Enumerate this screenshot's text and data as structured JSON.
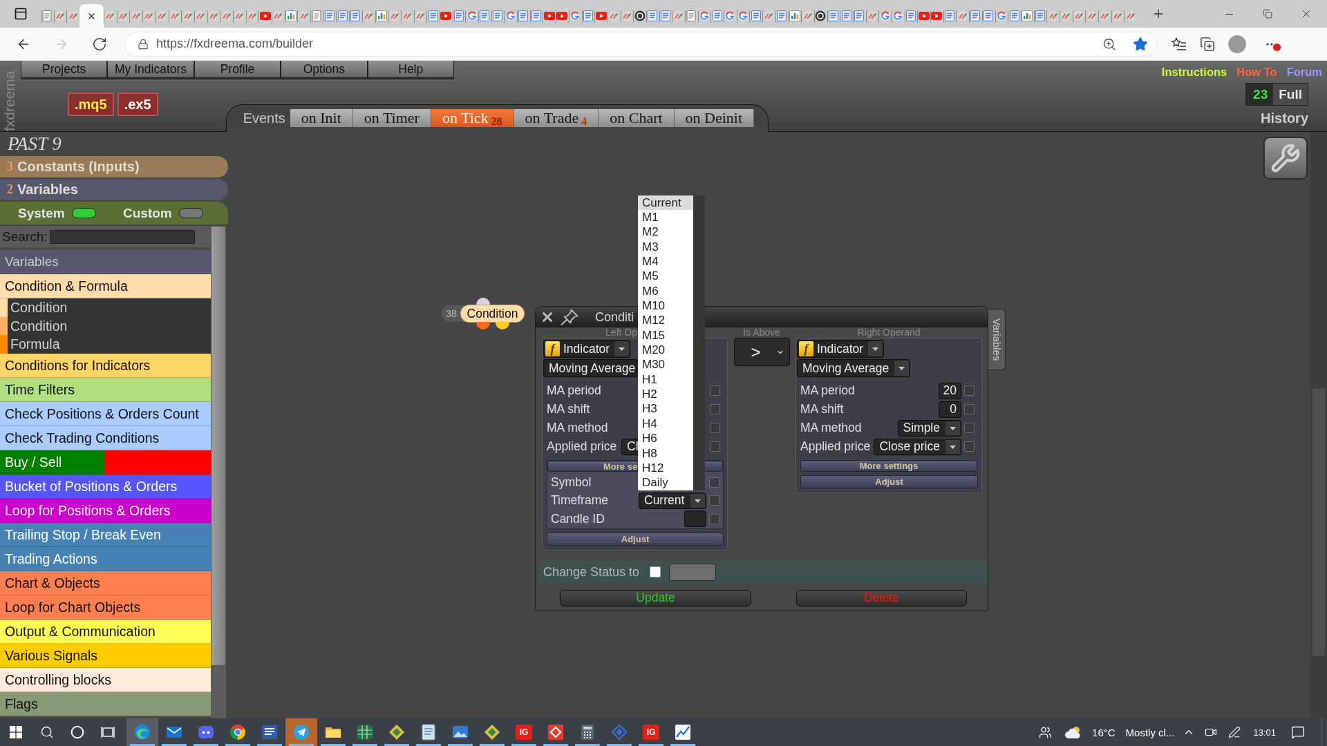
{
  "browser": {
    "tabs": [
      {
        "kind": "page",
        "selected": false
      },
      {
        "kind": "fx",
        "selected": false
      },
      {
        "kind": "fx",
        "selected": false
      },
      {
        "selected": true
      },
      {
        "kind": "fx",
        "selected": false
      },
      {
        "kind": "fx",
        "selected": false
      },
      {
        "kind": "fx",
        "selected": false
      },
      {
        "kind": "fx",
        "selected": false
      },
      {
        "kind": "fx",
        "selected": false
      },
      {
        "kind": "fx",
        "selected": false
      },
      {
        "kind": "fx",
        "selected": false
      },
      {
        "kind": "fx",
        "selected": false
      },
      {
        "kind": "fx",
        "selected": false
      },
      {
        "kind": "fx",
        "selected": false
      },
      {
        "kind": "fx",
        "selected": false
      },
      {
        "kind": "fx",
        "selected": false
      },
      {
        "kind": "youtube",
        "selected": false
      },
      {
        "kind": "fx",
        "selected": false
      },
      {
        "kind": "chart",
        "selected": false
      },
      {
        "kind": "fx",
        "selected": false
      },
      {
        "kind": "page",
        "selected": false
      },
      {
        "kind": "doc",
        "selected": false
      },
      {
        "kind": "doc",
        "selected": false
      },
      {
        "kind": "doc",
        "selected": false
      },
      {
        "kind": "fx",
        "selected": false
      },
      {
        "kind": "chart",
        "selected": false
      },
      {
        "kind": "fx",
        "selected": false
      },
      {
        "kind": "fx",
        "selected": false
      },
      {
        "kind": "fx",
        "selected": false
      },
      {
        "kind": "doc",
        "selected": false
      },
      {
        "kind": "youtube",
        "selected": false
      },
      {
        "kind": "doc",
        "selected": false
      },
      {
        "kind": "google",
        "selected": false
      },
      {
        "kind": "doc",
        "selected": false
      },
      {
        "kind": "doc",
        "selected": false
      },
      {
        "kind": "google",
        "selected": false
      },
      {
        "kind": "doc",
        "selected": false
      },
      {
        "kind": "doc",
        "selected": false
      },
      {
        "kind": "youtube",
        "selected": false
      },
      {
        "kind": "youtube",
        "selected": false
      },
      {
        "kind": "google",
        "selected": false
      },
      {
        "kind": "doc",
        "selected": false
      },
      {
        "kind": "youtube",
        "selected": false
      },
      {
        "kind": "fx",
        "selected": false
      },
      {
        "kind": "fx",
        "selected": false
      },
      {
        "kind": "circle",
        "selected": false
      },
      {
        "kind": "doc",
        "selected": false
      },
      {
        "kind": "doc",
        "selected": false
      },
      {
        "kind": "fx",
        "selected": false
      },
      {
        "kind": "page",
        "selected": false
      },
      {
        "kind": "google",
        "selected": false
      },
      {
        "kind": "doc",
        "selected": false
      },
      {
        "kind": "google",
        "selected": false
      },
      {
        "kind": "google",
        "selected": false
      },
      {
        "kind": "doc",
        "selected": false
      },
      {
        "kind": "fx",
        "selected": false
      },
      {
        "kind": "doc",
        "selected": false
      },
      {
        "kind": "chart",
        "selected": false
      },
      {
        "kind": "fx",
        "selected": false
      },
      {
        "kind": "circle",
        "selected": false
      },
      {
        "kind": "doc",
        "selected": false
      },
      {
        "kind": "doc",
        "selected": false
      },
      {
        "kind": "doc",
        "selected": false
      },
      {
        "kind": "fx",
        "selected": false
      },
      {
        "kind": "google",
        "selected": false
      },
      {
        "kind": "google",
        "selected": false
      },
      {
        "kind": "doc",
        "selected": false
      },
      {
        "kind": "youtube",
        "selected": false
      },
      {
        "kind": "youtube",
        "selected": false
      },
      {
        "kind": "doc",
        "selected": false
      },
      {
        "kind": "fx",
        "selected": false
      },
      {
        "kind": "doc",
        "selected": false
      },
      {
        "kind": "doc",
        "selected": false
      },
      {
        "kind": "google",
        "selected": false
      },
      {
        "kind": "doc",
        "selected": false
      },
      {
        "kind": "chart",
        "selected": false
      },
      {
        "kind": "doc",
        "selected": false
      },
      {
        "kind": "fx",
        "selected": false
      },
      {
        "kind": "fx",
        "selected": false
      },
      {
        "kind": "fx",
        "selected": false
      },
      {
        "kind": "fx",
        "selected": false
      },
      {
        "kind": "fx",
        "selected": false
      },
      {
        "kind": "fx",
        "selected": false
      },
      {
        "kind": "fx",
        "selected": false
      }
    ],
    "nav": [
      {
        "kind": "back",
        "disabled": false
      },
      {
        "kind": "forward",
        "disabled": true
      },
      {
        "kind": "reload",
        "disabled": false
      }
    ],
    "address": "https://fxdreema.com/builder",
    "favorite": true
  },
  "app": {
    "logo": "fxdreema",
    "menu": [
      "Projects",
      "My Indicators",
      "Profile",
      "Options",
      "Help"
    ],
    "links": [
      {
        "label": "Instructions",
        "color": "#ccff33"
      },
      {
        "label": "How To",
        "color": "#ff6640"
      },
      {
        "label": "Forum",
        "color": "#9a9aff"
      }
    ],
    "exports": [
      {
        "label": ".mq5",
        "kind": "source"
      },
      {
        "label": ".ex5",
        "kind": "compiled"
      }
    ],
    "events": {
      "label": "Events",
      "tabs": [
        {
          "label": "on Init",
          "selected": false
        },
        {
          "label": "on Timer",
          "selected": false
        },
        {
          "label": "on Tick",
          "count": "28",
          "selected": true
        },
        {
          "label": "on Trade",
          "count": "4",
          "selected": false
        },
        {
          "label": "on Chart",
          "selected": false
        },
        {
          "label": "on Deinit",
          "selected": false
        }
      ]
    },
    "history": {
      "count": "23",
      "mode": "Full",
      "label": "History"
    }
  },
  "sidebar": {
    "project": "PAST 9",
    "sections": [
      {
        "count": "3",
        "label": "Constants (Inputs)",
        "color": "#9b7a58"
      },
      {
        "count": "2",
        "label": "Variables",
        "color": "#56566c"
      }
    ],
    "toggles": [
      {
        "label": "System",
        "on": true
      },
      {
        "label": "Custom",
        "on": false
      }
    ],
    "search_label": "Search:",
    "header": "Variables",
    "categories": [
      {
        "label": "Condition & Formula",
        "color": "#ffdcaa",
        "children": [
          {
            "label": "Condition",
            "color": "#ffdcaa"
          },
          {
            "label": "Condition",
            "color": "#ffb060"
          },
          {
            "label": "Formula",
            "color": "#ff8800"
          }
        ]
      },
      {
        "label": "Conditions for Indicators",
        "color": "#ffd466"
      },
      {
        "label": "Time Filters",
        "color": "#b0e080"
      },
      {
        "label": "Check Positions & Orders Count",
        "color": "#aaccff"
      },
      {
        "label": "Check Trading Conditions",
        "color": "#aaccff"
      },
      {
        "label": "Buy / Sell",
        "parts": [
          {
            "color": "#008000"
          },
          {
            "color": "#ff0000"
          }
        ]
      },
      {
        "label": "Bucket of Positions & Orders",
        "color": "#5555ff"
      },
      {
        "label": "Loop for Positions & Orders",
        "color": "#cc00cc"
      },
      {
        "label": "Trailing Stop / Break Even",
        "color": "#4682b4"
      },
      {
        "label": "Trading Actions",
        "color": "#4682b4"
      },
      {
        "label": "Chart & Objects",
        "color": "#ff7f50"
      },
      {
        "label": "Loop for Chart Objects",
        "color": "#ff7f50"
      },
      {
        "label": "Output & Communication",
        "color": "#ffff55"
      },
      {
        "label": "Various Signals",
        "color": "#ffcc00"
      },
      {
        "label": "Controlling blocks",
        "color": "#ffeadc"
      },
      {
        "label": "Flags",
        "color": "#889977"
      }
    ]
  },
  "node": {
    "number": "38",
    "label": "Condition"
  },
  "dialog": {
    "title": "Conditi",
    "side_tab": "Variables",
    "left": {
      "heading": "Left Op",
      "source_icon": "f",
      "source": "Indicator",
      "indicator": "Moving Average",
      "params": [
        {
          "label": "MA period",
          "checked": false
        },
        {
          "label": "MA shift",
          "checked": false
        },
        {
          "label": "MA method",
          "checked": false
        },
        {
          "label": "Applied price",
          "kind": "select",
          "value": "Cl",
          "checked": false
        }
      ],
      "more": "More se",
      "extra": [
        {
          "label": "Symbol",
          "checked": false,
          "disabled": true
        },
        {
          "label": "Timeframe",
          "kind": "select",
          "value": "Current",
          "checked": false,
          "disabled": false
        },
        {
          "label": "Candle ID",
          "kind": "field",
          "checked": false,
          "disabled": false
        }
      ],
      "adjust": "Adjust"
    },
    "operator": {
      "heading": "Is Above",
      "symbol": ">"
    },
    "right": {
      "heading": "Right Operand",
      "source_icon": "f",
      "source": "Indicator",
      "indicator": "Moving Average",
      "params": [
        {
          "label": "MA period",
          "kind": "field",
          "value": "20",
          "checked": false
        },
        {
          "label": "MA shift",
          "kind": "field",
          "value": "0",
          "checked": false
        },
        {
          "label": "MA method",
          "kind": "select",
          "value": "Simple",
          "checked": false
        },
        {
          "label": "Applied price",
          "kind": "select",
          "value": "Close price",
          "checked": false
        }
      ],
      "more": "More settings",
      "adjust": "Adjust"
    },
    "status": {
      "label": "Change Status to",
      "checked": false
    },
    "buttons": [
      {
        "label": "Update",
        "kind": "update"
      },
      {
        "label": "Delete",
        "kind": "delete"
      }
    ]
  },
  "timeframe_menu": {
    "options": [
      {
        "label": "Current",
        "selected": true
      },
      {
        "label": "M1",
        "selected": false
      },
      {
        "label": "M2",
        "selected": false
      },
      {
        "label": "M3",
        "selected": false
      },
      {
        "label": "M4",
        "selected": false
      },
      {
        "label": "M5",
        "selected": false
      },
      {
        "label": "M6",
        "selected": false
      },
      {
        "label": "M10",
        "selected": false
      },
      {
        "label": "M12",
        "selected": false
      },
      {
        "label": "M15",
        "selected": false
      },
      {
        "label": "M20",
        "selected": false
      },
      {
        "label": "M30",
        "selected": false
      },
      {
        "label": "H1",
        "selected": false
      },
      {
        "label": "H2",
        "selected": false
      },
      {
        "label": "H3",
        "selected": false
      },
      {
        "label": "H4",
        "selected": false
      },
      {
        "label": "H6",
        "selected": false
      },
      {
        "label": "H8",
        "selected": false
      },
      {
        "label": "H12",
        "selected": false
      },
      {
        "label": "Daily",
        "selected": false
      }
    ]
  },
  "taskbar": {
    "apps": [
      {
        "kind": "edge",
        "selected": true,
        "running": true,
        "flashing": false
      },
      {
        "kind": "mail",
        "selected": false,
        "running": true,
        "flashing": false
      },
      {
        "kind": "chat",
        "selected": false,
        "running": true,
        "flashing": false
      },
      {
        "kind": "chrome",
        "selected": false,
        "running": true,
        "flashing": false
      },
      {
        "kind": "word",
        "selected": false,
        "running": true,
        "flashing": false
      },
      {
        "kind": "telegram",
        "selected": false,
        "running": true,
        "flashing": true
      },
      {
        "kind": "folder",
        "selected": false,
        "running": true,
        "flashing": false
      },
      {
        "kind": "excel",
        "selected": false,
        "running": true,
        "flashing": false
      },
      {
        "kind": "diamond",
        "selected": false,
        "running": true,
        "flashing": false
      },
      {
        "kind": "notepad",
        "selected": false,
        "running": true,
        "flashing": false
      },
      {
        "kind": "photos",
        "selected": false,
        "running": true,
        "flashing": false
      },
      {
        "kind": "diamond",
        "selected": false,
        "running": true,
        "flashing": false
      },
      {
        "kind": "tile",
        "label": "IG",
        "selected": false,
        "running": true,
        "flashing": false
      },
      {
        "kind": "remote",
        "selected": false,
        "running": true,
        "flashing": false
      },
      {
        "kind": "calculator",
        "selected": false,
        "running": true,
        "flashing": false
      },
      {
        "kind": "gem",
        "selected": false,
        "running": true,
        "flashing": false
      },
      {
        "kind": "tile",
        "label": "IG",
        "selected": false,
        "running": true,
        "flashing": false
      },
      {
        "kind": "chart",
        "selected": false,
        "running": true,
        "flashing": false
      }
    ],
    "temperature": "16°C",
    "weather": "Mostly cl...",
    "time": "13:01"
  }
}
